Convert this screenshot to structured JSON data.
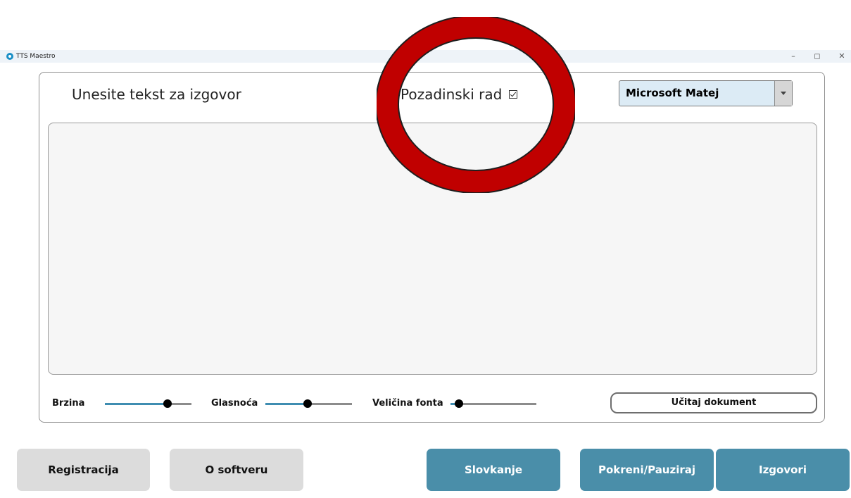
{
  "window": {
    "title": "TTS Maestro",
    "controls": {
      "minimize": "–",
      "maximize": "◻",
      "close": "✕"
    }
  },
  "header": {
    "prompt_label": "Unesite tekst za izgovor",
    "background_mode_label": "Pozadinski rad",
    "background_mode_checked": true,
    "voice_select_value": "Microsoft Matej"
  },
  "text_area": {
    "value": ""
  },
  "sliders": {
    "speed": {
      "label": "Brzina",
      "level_percent": 72
    },
    "volume": {
      "label": "Glasnoća",
      "level_percent": 49
    },
    "font_size": {
      "label": "Veličina fonta",
      "level_percent": 10
    }
  },
  "load_document_button": "Učitaj dokument",
  "bottom_buttons": {
    "registration": "Registracija",
    "about": "O softveru",
    "spelling": "Slovkanje",
    "play_pause": "Pokreni/Pauziraj",
    "speak": "Izgovori"
  },
  "colors": {
    "accent_teal": "#4a8ea9",
    "slider_fill": "#3f8db1",
    "highlight_ring": "#c00000",
    "select_bg": "#dcebf5"
  },
  "icons": {
    "app": "app-logo-icon",
    "checkbox": "checkmark-icon",
    "dropdown": "chevron-down-icon"
  }
}
